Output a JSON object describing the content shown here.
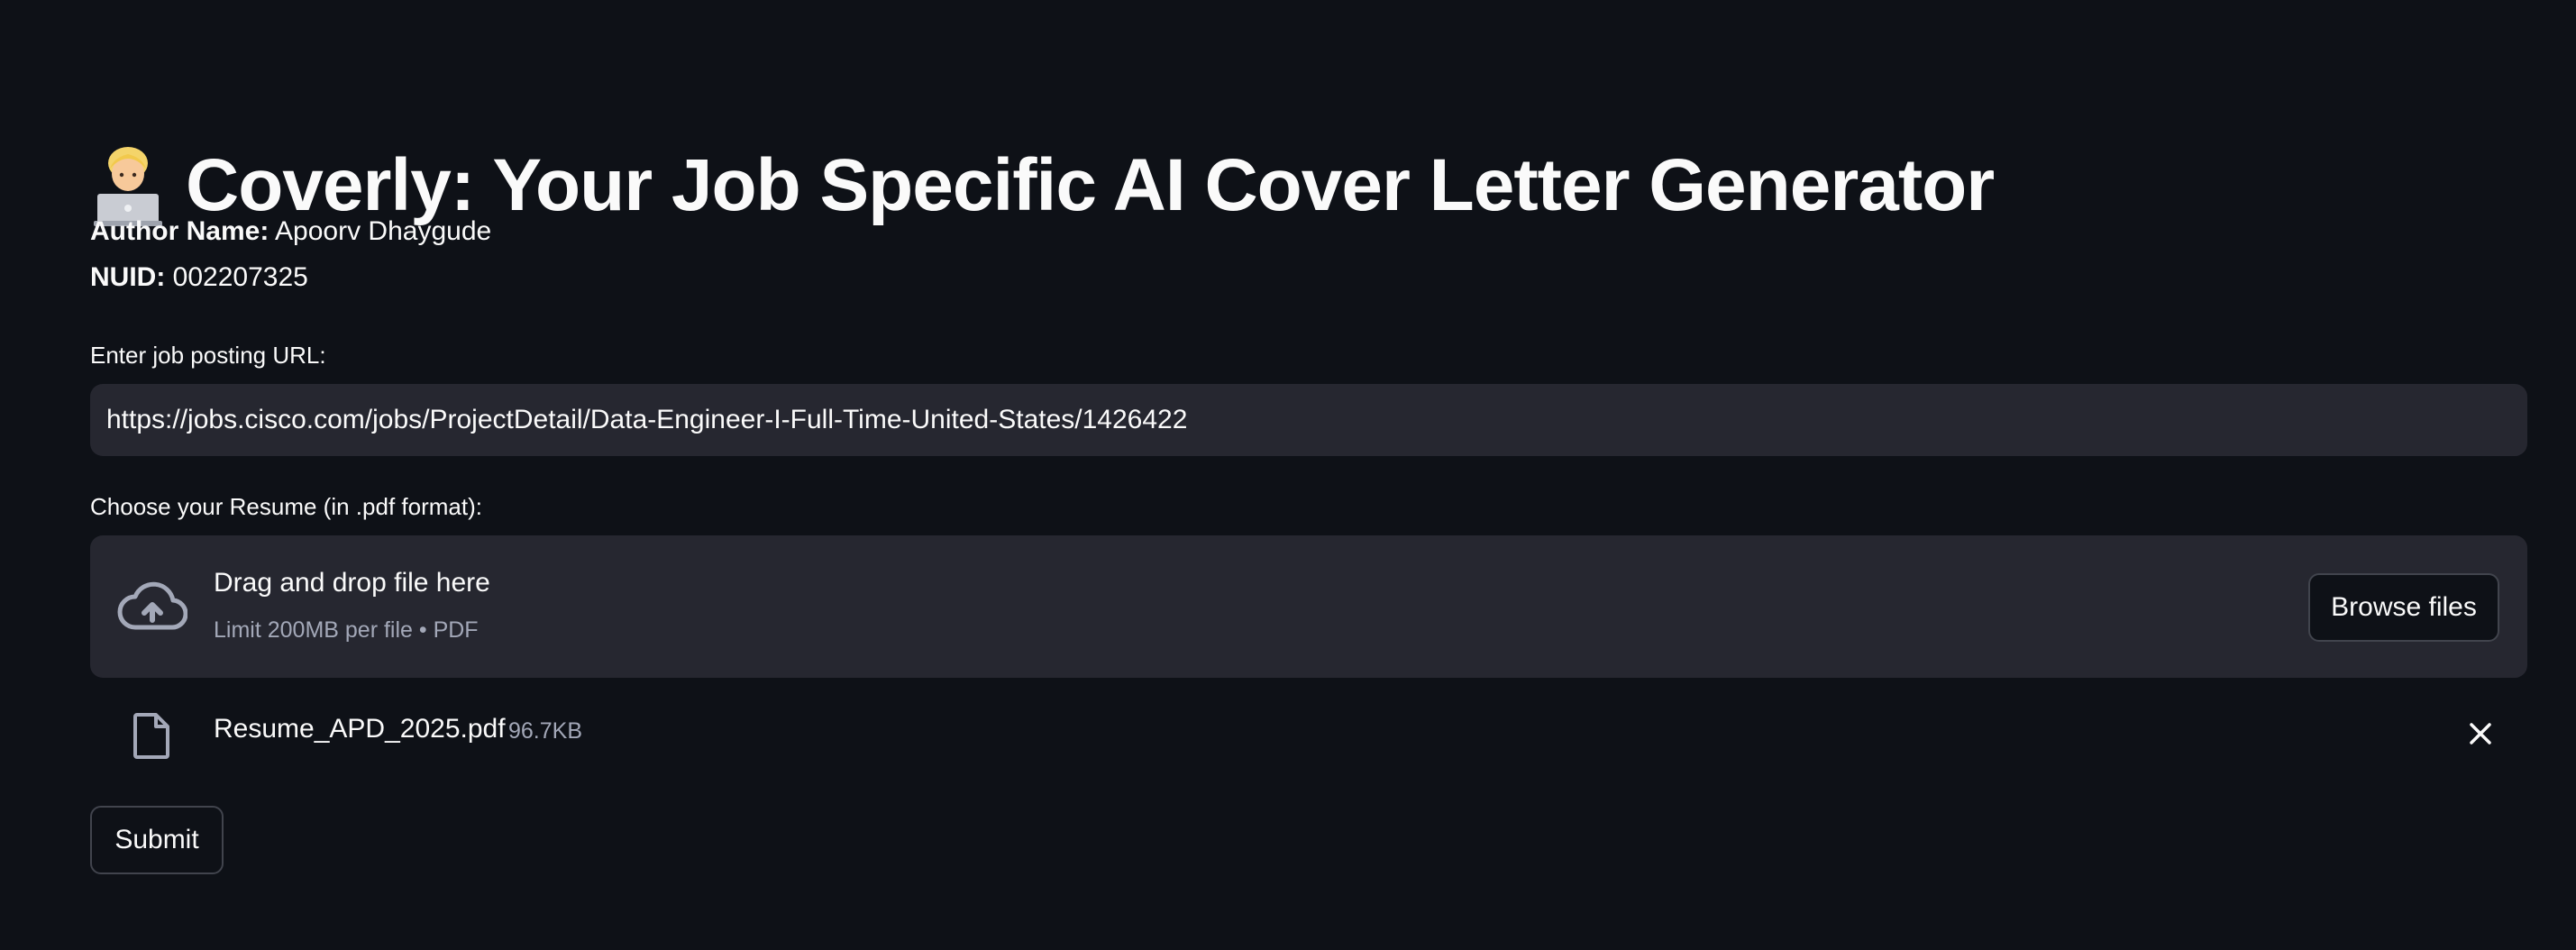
{
  "title": "Coverly: Your Job Specific AI Cover Letter Generator",
  "title_icon": "technologist-emoji",
  "author": {
    "label": "Author Name:",
    "value": "Apoorv Dhaygude"
  },
  "nuid": {
    "label": "NUID:",
    "value": "002207325"
  },
  "url_field": {
    "label": "Enter job posting URL:",
    "value": "https://jobs.cisco.com/jobs/ProjectDetail/Data-Engineer-I-Full-Time-United-States/1426422"
  },
  "uploader": {
    "label": "Choose your Resume (in .pdf format):",
    "dropzone_title": "Drag and drop file here",
    "dropzone_subtitle": "Limit 200MB per file • PDF",
    "browse_label": "Browse files",
    "icon": "cloud-upload-icon"
  },
  "uploaded_file": {
    "name": "Resume_APD_2025.pdf",
    "size": "96.7KB",
    "icon": "file-icon",
    "remove_icon": "close-icon"
  },
  "submit_label": "Submit",
  "colors": {
    "background": "#0e1117",
    "surface": "#262730",
    "text": "#fafafa",
    "muted": "#a3a8b8",
    "border": "#41444d"
  }
}
